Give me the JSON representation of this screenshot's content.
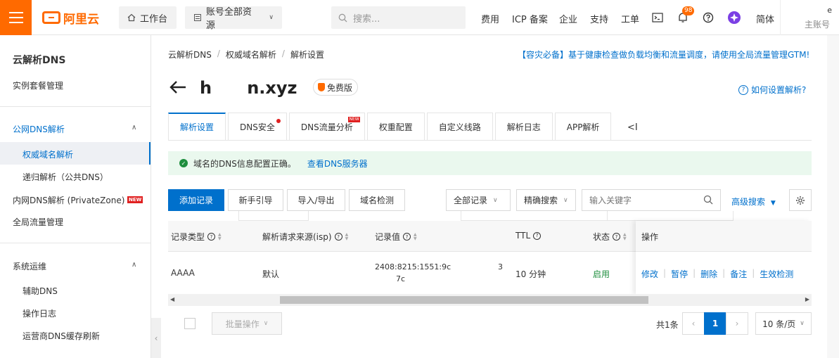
{
  "topbar": {
    "logo_text": "阿里云",
    "workbench": "工作台",
    "resources": "账号全部资源",
    "search_placeholder": "搜索...",
    "links": [
      "费用",
      "ICP 备案",
      "企业",
      "支持",
      "工单"
    ],
    "notify_count": "98",
    "lang": "简体",
    "account_initial": "e",
    "account_sub": "主账号",
    "brand_color": "#ff6a00"
  },
  "sidebar": {
    "title": "云解析DNS",
    "instance": "实例套餐管理",
    "public_dns": "公网DNS解析",
    "authoritative": "权威域名解析",
    "recursive": "递归解析（公共DNS）",
    "private_zone": "内网DNS解析 (PrivateZone)",
    "new_badge": "NEW",
    "gtm": "全局流量管理",
    "ops": "系统运维",
    "assist": "辅助DNS",
    "oplog": "操作日志",
    "isp_flush": "运营商DNS缓存刷新"
  },
  "breadcrumb": [
    "云解析DNS",
    "权威域名解析",
    "解析设置"
  ],
  "notice": "【容灾必备】基于健康检查做负载均衡和流量调度，请使用全局流量管理GTM!",
  "domain": {
    "name": "h      n.xyz",
    "tag": "免费版",
    "help": "如何设置解析?"
  },
  "tabs": [
    "解析设置",
    "DNS安全",
    "DNS流量分析",
    "权重配置",
    "自定义线路",
    "解析日志",
    "APP解析"
  ],
  "tab_new_badge": "NEW",
  "tab_more": "<I",
  "status": {
    "message": "域名的DNS信息配置正确。",
    "link": "查看DNS服务器"
  },
  "toolbar": {
    "add": "添加记录",
    "guide": "新手引导",
    "import_export": "导入/导出",
    "check": "域名检测",
    "all_records": "全部记录",
    "exact": "精确搜索",
    "keyword_placeholder": "输入关键字",
    "advanced": "高级搜索"
  },
  "table": {
    "headers": {
      "type": "记录类型",
      "isp": "解析请求来源(isp)",
      "value": "记录值",
      "ttl": "TTL",
      "status": "状态",
      "ops": "操作"
    },
    "row": {
      "type": "AAAA",
      "isp": "默认",
      "value_line1": "2408:8215:1551:9c",
      "value_tail": "3",
      "value_line2": "7c",
      "ttl": "10 分钟",
      "status": "启用"
    },
    "actions": [
      "修改",
      "暂停",
      "删除",
      "备注",
      "生效检测"
    ]
  },
  "footer": {
    "batch": "批量操作",
    "total": "共1条",
    "page": "1",
    "per_page": "10 条/页"
  }
}
